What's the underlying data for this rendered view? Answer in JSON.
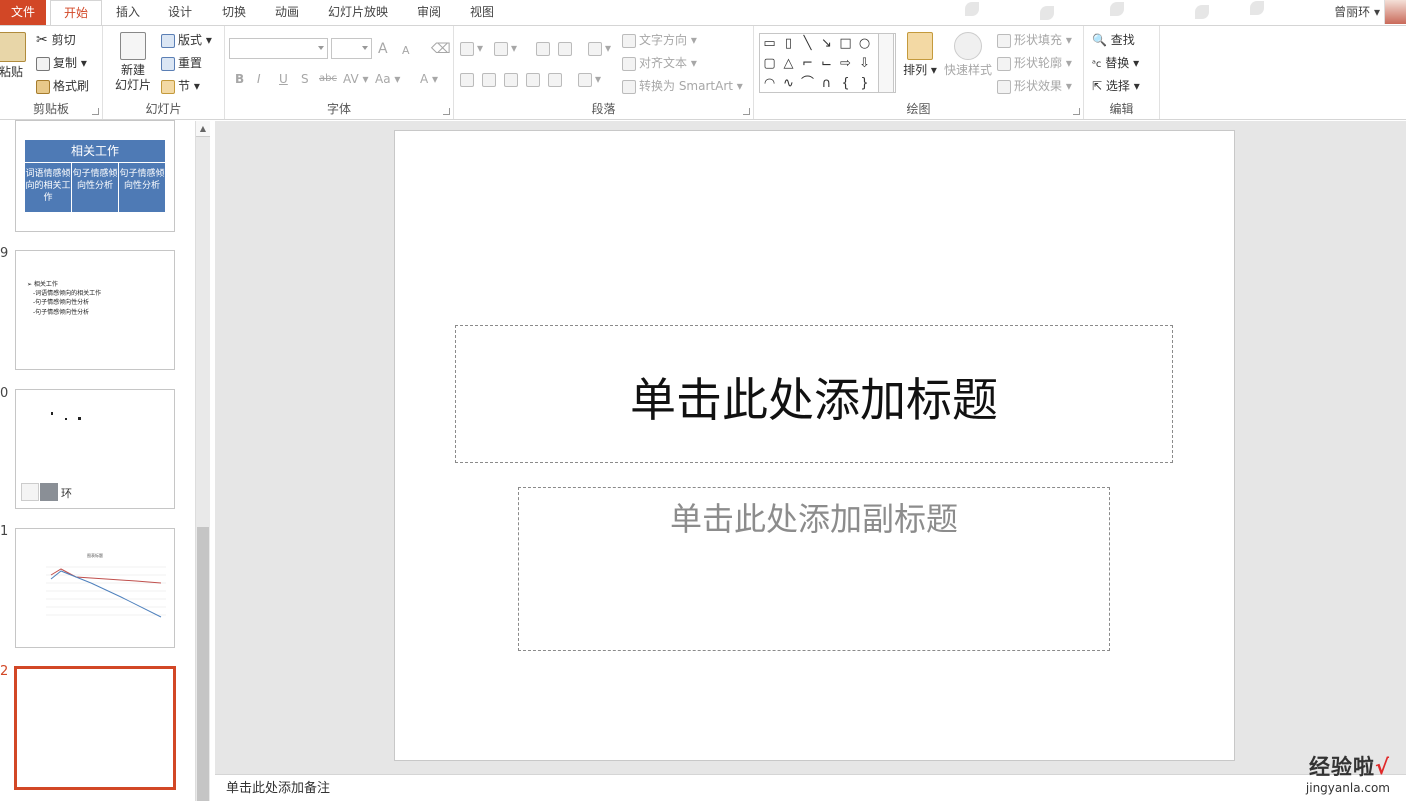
{
  "tabs": {
    "file": "文件",
    "home": "开始",
    "insert": "插入",
    "design": "设计",
    "transitions": "切换",
    "animations": "动画",
    "slideshow": "幻灯片放映",
    "review": "审阅",
    "view": "视图"
  },
  "user": {
    "name": "曾丽环"
  },
  "ribbon": {
    "clipboard": {
      "paste": "粘贴",
      "cut": "剪切",
      "copy": "复制",
      "format_painter": "格式刷",
      "label": "剪贴板"
    },
    "slides": {
      "new_slide_line1": "新建",
      "new_slide_line2": "幻灯片",
      "layout": "版式",
      "reset": "重置",
      "section": "节",
      "label": "幻灯片"
    },
    "font": {
      "label": "字体",
      "grow": "A",
      "shrink": "A",
      "bold": "B",
      "italic": "I",
      "underline": "U",
      "shadow": "S",
      "strike": "abc",
      "spacing": "AV",
      "case": "Aa",
      "color": "A"
    },
    "paragraph": {
      "label": "段落",
      "text_direction": "文字方向",
      "align_text": "对齐文本",
      "convert_smartart": "转换为 SmartArt"
    },
    "drawing": {
      "label": "绘图",
      "arrange": "排列",
      "quick_styles": "快速样式",
      "shape_fill": "形状填充",
      "shape_outline": "形状轮廓",
      "shape_effects": "形状效果"
    },
    "editing": {
      "label": "编辑",
      "find": "查找",
      "replace": "替换",
      "select": "选择"
    }
  },
  "slides_panel": {
    "items": [
      {
        "number": "",
        "title": "相关工作",
        "cols": [
          "词语情感倾向的相关工作",
          "句子情感倾向性分析",
          "句子情感倾向性分析"
        ]
      },
      {
        "number": "9",
        "lines": [
          "➢ 相关工作",
          "-词语情感倾向的相关工作",
          "-句子情感倾向性分析",
          "-句子情感倾向性分析"
        ]
      },
      {
        "number": "0",
        "caption": "环"
      },
      {
        "number": "1",
        "chart_label": "图表标题"
      },
      {
        "number": "2",
        "selected": true
      }
    ]
  },
  "slide": {
    "title_placeholder": "单击此处添加标题",
    "subtitle_placeholder": "单击此处添加副标题"
  },
  "notes": {
    "placeholder": "单击此处添加备注"
  },
  "watermark": {
    "line1": "经验啦",
    "check": "√",
    "line2": "jingyanla.com"
  },
  "colors": {
    "accent": "#d24726",
    "table_blue": "#4e7ab5"
  }
}
